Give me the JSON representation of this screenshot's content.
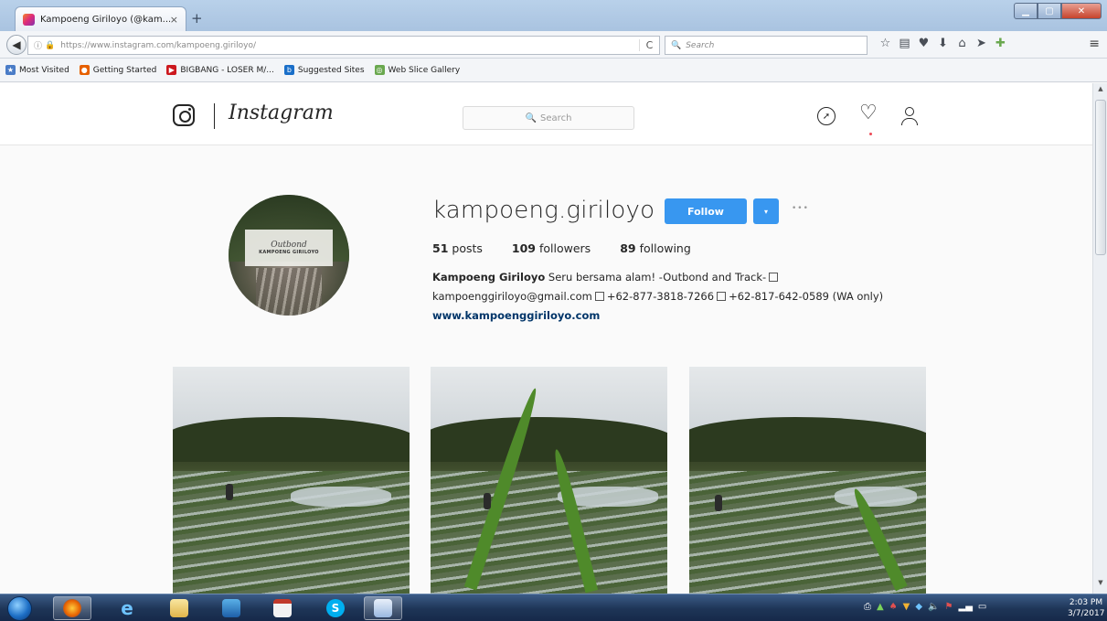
{
  "browser": {
    "tab_title": "Kampoeng Giriloyo (@kam...",
    "tab_close": "×",
    "new_tab": "+",
    "url": "https://www.instagram.com/kampoeng.giriloyo/",
    "search_placeholder": "Search",
    "reload": "C",
    "bookmarks": [
      {
        "label": "Most Visited",
        "color": "#4a7cc7"
      },
      {
        "label": "Getting Started",
        "color": "#e66000"
      },
      {
        "label": "BIGBANG - LOSER M/...",
        "color": "#cc181e"
      },
      {
        "label": "Suggested Sites",
        "color": "#1a6fc9"
      },
      {
        "label": "Web Slice Gallery",
        "color": "#6aa84f"
      }
    ]
  },
  "instagram": {
    "wordmark": "Instagram",
    "search_placeholder": "Search",
    "profile": {
      "username": "kampoeng.giriloyo",
      "follow_label": "Follow",
      "dropdown_label": "▾",
      "more_label": "•••",
      "posts_count": "51",
      "posts_label": "posts",
      "followers_count": "109",
      "followers_label": "followers",
      "following_count": "89",
      "following_label": "following",
      "bio_name": "Kampoeng Giriloyo",
      "bio_text_1": "Seru bersama alam! -Outbond and Track-",
      "bio_email": "kampoenggiriloyo@gmail.com",
      "bio_phone_1": "+62-877-3818-7266",
      "bio_phone_2": "+62-817-642-0589 (WA only)",
      "bio_link": "www.kampoenggiriloyo.com",
      "avatar_text_1": "Outbond",
      "avatar_text_2": "KAMPOENG GIRILOYO"
    }
  },
  "taskbar": {
    "time": "2:03 PM",
    "date": "3/7/2017"
  },
  "colors": {
    "follow_blue": "#3897f0",
    "link": "#003569"
  }
}
